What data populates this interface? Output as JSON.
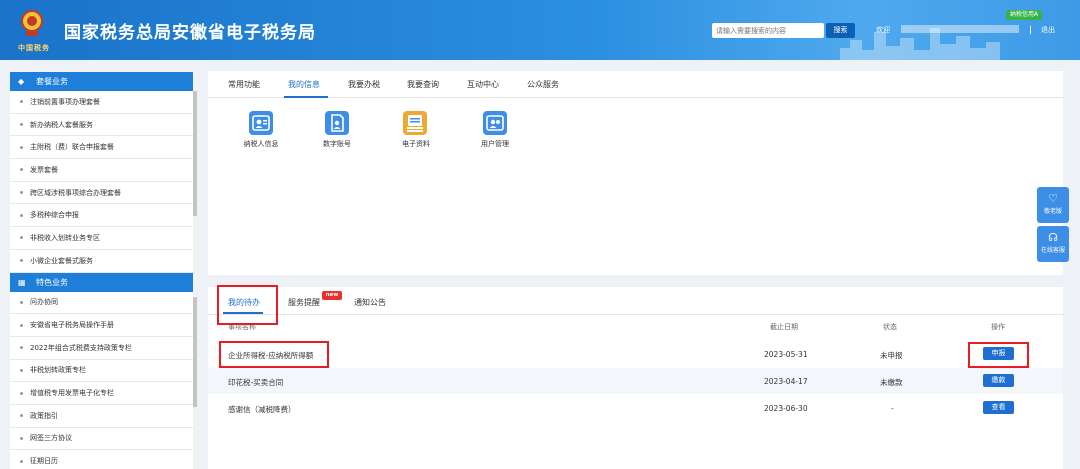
{
  "header": {
    "site_title": "国家税务总局安徽省电子税务局",
    "logo_sub": "中国税务",
    "search_placeholder": "请输入需要搜索的内容",
    "search_button": "搜索",
    "welcome": "欢迎",
    "credit_badge": "纳税信用A",
    "logout": "退出"
  },
  "sidebar": {
    "group1_title": "套餐业务",
    "group1_items": [
      "注销前置事项办理套餐",
      "新办纳税人套餐服务",
      "主附税（费）联合申报套餐",
      "发票套餐",
      "跨区域涉税事项综合办理套餐",
      "多税种综合申报",
      "非税收入划转业务专区",
      "小微企业套餐式服务"
    ],
    "group2_title": "特色业务",
    "group2_items": [
      "问办协同",
      "安徽省电子税务局操作手册",
      "2022年组合式税费支持政策专栏",
      "非税划转政策专栏",
      "增值税专用发票电子化专栏",
      "政策指引",
      "网签三方协议",
      "征期日历"
    ]
  },
  "top_tabs": [
    "常用功能",
    "我的信息",
    "我要办税",
    "我要查询",
    "互动中心",
    "公众服务"
  ],
  "apps": [
    {
      "label": "纳税人信息",
      "icon": "person-card-icon"
    },
    {
      "label": "数字账号",
      "icon": "document-user-icon"
    },
    {
      "label": "电子资料",
      "icon": "file-stack-icon"
    },
    {
      "label": "用户管理",
      "icon": "users-icon"
    }
  ],
  "float": {
    "elder_mode": "敬老版",
    "online_service": "在线客服"
  },
  "bottom": {
    "tabs": [
      "我的待办",
      "服务提醒",
      "通知公告"
    ],
    "new_badge": "new",
    "columns": [
      "事项名称",
      "截止日期",
      "状态",
      "操作"
    ],
    "rows": [
      {
        "name": "企业所得税-应纳税所得额",
        "deadline": "2023-05-31",
        "status": "未申报",
        "action": "申报"
      },
      {
        "name": "印花税-买卖合同",
        "deadline": "2023-04-17",
        "status": "未缴款",
        "action": "缴款"
      },
      {
        "name": "感谢信（减税降费）",
        "deadline": "2023-06-30",
        "status": "-",
        "action": "查看"
      }
    ]
  },
  "colors": {
    "brand_blue": "#1f6fd0",
    "header_blue": "#2b8fe0",
    "highlight_red": "#e81c23",
    "badge_green": "#37b34a"
  }
}
